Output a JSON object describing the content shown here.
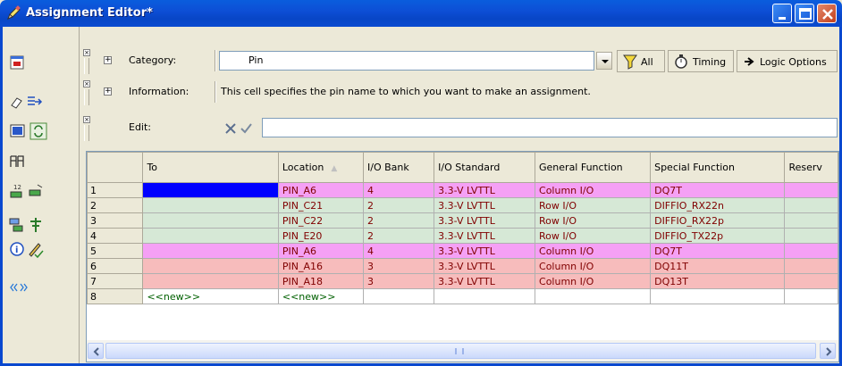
{
  "window": {
    "title": "Assignment Editor*"
  },
  "category": {
    "label": "Category:",
    "value": "Pin"
  },
  "toolbar": {
    "all_label": "All",
    "timing_label": "Timing",
    "logic_options_label": "Logic Options"
  },
  "information": {
    "label": "Information:",
    "text": "This cell specifies the pin name to which you want to make an assignment."
  },
  "edit": {
    "label": "Edit:",
    "value": ""
  },
  "table": {
    "columns": [
      "To",
      "Location",
      "I/O Bank",
      "I/O Standard",
      "General Function",
      "Special Function",
      "Reserv"
    ],
    "rows": [
      {
        "num": "1",
        "to": "",
        "location": "PIN_A6",
        "bank": "4",
        "standard": "3.3-V LVTTL",
        "general": "Column I/O",
        "special": "DQ7T",
        "style": "mag"
      },
      {
        "num": "2",
        "to": "",
        "location": "PIN_C21",
        "bank": "2",
        "standard": "3.3-V LVTTL",
        "general": "Row I/O",
        "special": "DIFFIO_RX22n",
        "style": "grn"
      },
      {
        "num": "3",
        "to": "",
        "location": "PIN_C22",
        "bank": "2",
        "standard": "3.3-V LVTTL",
        "general": "Row I/O",
        "special": "DIFFIO_RX22p",
        "style": "grn"
      },
      {
        "num": "4",
        "to": "",
        "location": "PIN_E20",
        "bank": "2",
        "standard": "3.3-V LVTTL",
        "general": "Row I/O",
        "special": "DIFFIO_TX22p",
        "style": "grn"
      },
      {
        "num": "5",
        "to": "",
        "location": "PIN_A6",
        "bank": "4",
        "standard": "3.3-V LVTTL",
        "general": "Column I/O",
        "special": "DQ7T",
        "style": "mag"
      },
      {
        "num": "6",
        "to": "",
        "location": "PIN_A16",
        "bank": "3",
        "standard": "3.3-V LVTTL",
        "general": "Column I/O",
        "special": "DQ11T",
        "style": "pink"
      },
      {
        "num": "7",
        "to": "",
        "location": "PIN_A18",
        "bank": "3",
        "standard": "3.3-V LVTTL",
        "general": "Column I/O",
        "special": "DQ13T",
        "style": "pink"
      },
      {
        "num": "8",
        "to": "<<new>>",
        "location": "<<new>>",
        "bank": "",
        "standard": "",
        "general": "",
        "special": "",
        "style": "new"
      }
    ]
  },
  "colors": {
    "titlebar": "#0a5ddd",
    "row_magenta": "#f5a0f5",
    "row_green": "#d6e8d6",
    "row_pink": "#f7bcbc",
    "selection": "#0000ff",
    "cell_text": "#800000",
    "new_text": "#006000"
  },
  "icons": {
    "title": "pencil-icon",
    "left_toolbar": [
      "assignment-icon",
      "eraser-icon",
      "export-arrow-icon",
      "window-icon",
      "refresh-icon",
      "pin-planner-icon",
      "sort-ascending-icon",
      "sort-descending-icon",
      "filter-icon",
      "node-finder-icon",
      "info-icon",
      "edit-check-icon",
      "expand-chevrons-icon"
    ]
  }
}
